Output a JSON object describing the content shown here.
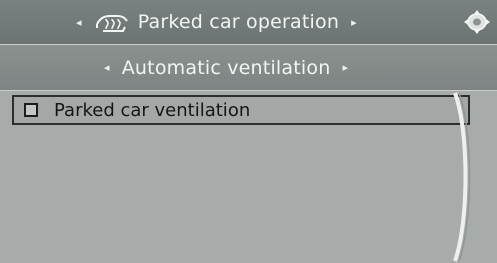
{
  "header": {
    "title": "Parked car operation",
    "left_arrow": "◂",
    "right_arrow": "▸",
    "icon": "parked-car-heating-icon",
    "controller_icon": "controller-icon"
  },
  "subheader": {
    "title": "Automatic ventilation",
    "left_arrow": "◂",
    "right_arrow": "▸"
  },
  "list": {
    "items": [
      {
        "label": "Parked car ventilation",
        "checked": false
      }
    ]
  },
  "colors": {
    "screen_bg": "#a7abaa",
    "header_bg": "#6c7473",
    "subheader_bg": "#7d8483",
    "text_light": "#f3f5f4",
    "text_dark": "#141616"
  }
}
